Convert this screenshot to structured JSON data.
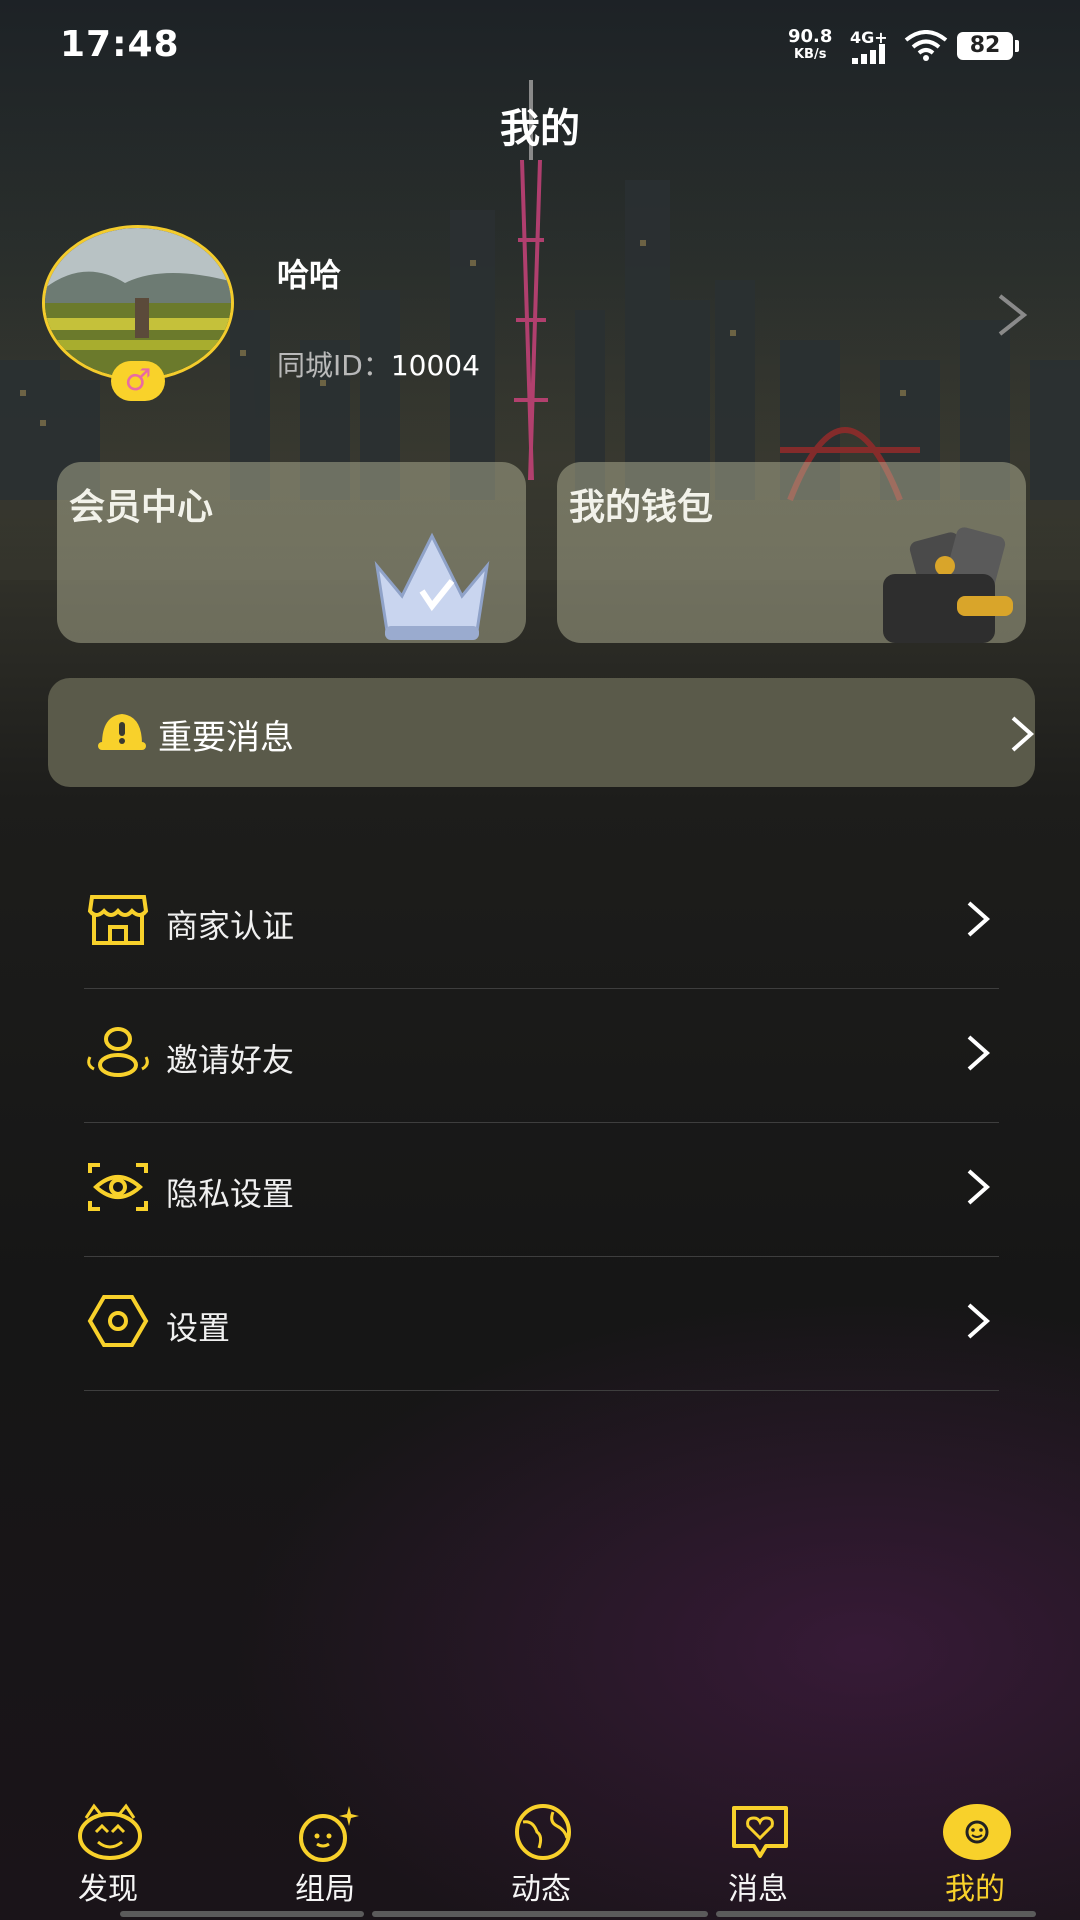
{
  "status_bar": {
    "time": "17:48",
    "net_speed_value": "90.8",
    "net_speed_unit": "KB/s",
    "network_type": "4G+",
    "battery": "82"
  },
  "header": {
    "title": "我的"
  },
  "profile": {
    "username": "哈哈",
    "id_label": "同城ID：",
    "id_value": "10004",
    "gender_symbol": "♂"
  },
  "cards": {
    "vip_label": "会员中心",
    "wallet_label": "我的钱包"
  },
  "notice": {
    "label": "重要消息"
  },
  "menu": [
    {
      "label": "商家认证",
      "icon": "shop-icon"
    },
    {
      "label": "邀请好友",
      "icon": "invite-friends-icon"
    },
    {
      "label": "隐私设置",
      "icon": "privacy-eye-icon"
    },
    {
      "label": "设置",
      "icon": "settings-hexagon-icon"
    }
  ],
  "tabs": [
    {
      "label": "发现",
      "icon": "discover-icon",
      "active": false
    },
    {
      "label": "组局",
      "icon": "group-icon",
      "active": false
    },
    {
      "label": "动态",
      "icon": "moments-globe-icon",
      "active": false
    },
    {
      "label": "消息",
      "icon": "message-heart-icon",
      "active": false
    },
    {
      "label": "我的",
      "icon": "me-smile-icon",
      "active": true
    }
  ],
  "colors": {
    "accent": "#f8d12b",
    "card_bg": "#8b8b72",
    "notice_bg": "#5a5a4a",
    "gender_symbol": "#e96ba2"
  }
}
